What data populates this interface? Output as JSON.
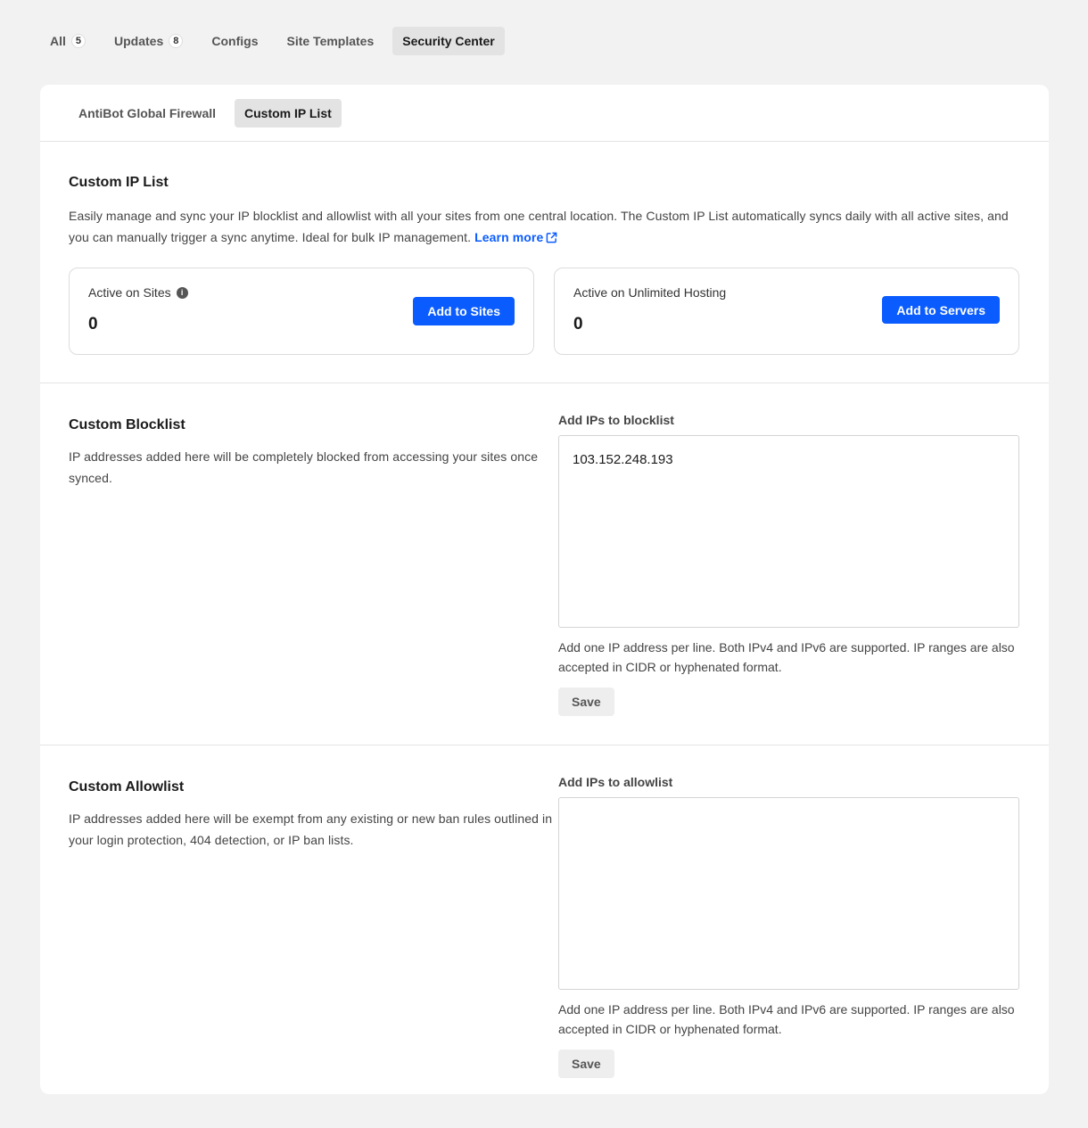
{
  "top_tabs": [
    {
      "label": "All",
      "count": "5"
    },
    {
      "label": "Updates",
      "count": "8"
    },
    {
      "label": "Configs"
    },
    {
      "label": "Site Templates"
    },
    {
      "label": "Security Center"
    }
  ],
  "sub_tabs": [
    {
      "label": "AntiBot Global Firewall"
    },
    {
      "label": "Custom IP List"
    }
  ],
  "intro": {
    "title": "Custom IP List",
    "description": "Easily manage and sync your IP blocklist and allowlist with all your sites from one central location. The Custom IP List automatically syncs daily with all active sites, and you can manually trigger a sync anytime. Ideal for bulk IP management.",
    "learn_more": "Learn more"
  },
  "stats": {
    "sites": {
      "label": "Active on Sites",
      "value": "0",
      "button": "Add to Sites",
      "info_icon": "i"
    },
    "hosting": {
      "label": "Active on Unlimited Hosting",
      "value": "0",
      "button": "Add to Servers"
    }
  },
  "blocklist": {
    "title": "Custom Blocklist",
    "description": "IP addresses added here will be completely blocked from accessing your sites once synced.",
    "field_label": "Add IPs to blocklist",
    "value": "103.152.248.193",
    "help": "Add one IP address per line. Both IPv4 and IPv6 are supported. IP ranges are also accepted in CIDR or hyphenated format.",
    "save": "Save"
  },
  "allowlist": {
    "title": "Custom Allowlist",
    "description": "IP addresses added here will be exempt from any existing or new ban rules outlined in your login protection, 404 detection, or IP ban lists.",
    "field_label": "Add IPs to allowlist",
    "value": "",
    "help": "Add one IP address per line. Both IPv4 and IPv6 are supported. IP ranges are also accepted in CIDR or hyphenated format.",
    "save": "Save"
  },
  "colors": {
    "accent": "#0a5cff",
    "background": "#f2f2f2",
    "card": "#ffffff",
    "active_tab": "#e3e3e3"
  }
}
